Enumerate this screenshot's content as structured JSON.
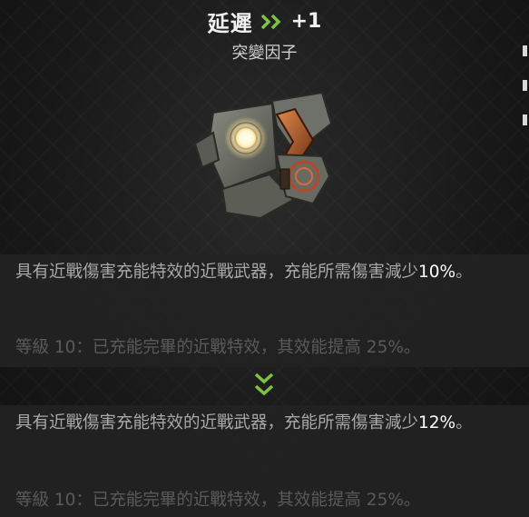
{
  "header": {
    "title": "延遲",
    "rank_change": "+1",
    "subtitle": "突變因子"
  },
  "icons": {
    "rank_up": "double-chevron-right-icon",
    "upgrade_arrow": "double-chevron-down-icon"
  },
  "current": {
    "description": "具有近戰傷害充能特效的近戰武器，充能所需傷害減少",
    "value": "10%",
    "value_suffix": "。",
    "level_bonus": "等級 10：已充能完畢的近戰特效，其效能提高 25%。"
  },
  "next": {
    "description": "具有近戰傷害充能特效的近戰武器，充能所需傷害減少",
    "value": "12%",
    "value_suffix": "。",
    "level_bonus": "等級 10：已充能完畢的近戰特效，其效能提高 25%。"
  },
  "colors": {
    "accent_green": "#7ec242",
    "text_primary": "#f0f0f0",
    "text_secondary": "#a8a8a8",
    "text_dim": "#5a5a5a",
    "highlight_value": "#ffffff"
  }
}
